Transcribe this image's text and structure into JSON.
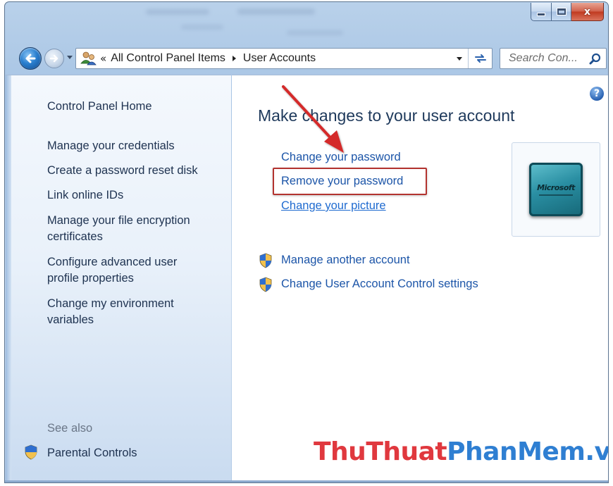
{
  "window": {
    "caption_buttons": {
      "minimize_icon": "minimize-icon",
      "maximize_icon": "maximize-icon",
      "close_icon": "close-icon",
      "close_glyph": "x"
    }
  },
  "toolbar": {
    "address": {
      "overflow_chevron": "«",
      "breadcrumbs": [
        "All Control Panel Items",
        "User Accounts"
      ]
    },
    "search": {
      "placeholder": "Search Con..."
    }
  },
  "left_pane": {
    "home_link": "Control Panel Home",
    "items": [
      "Manage your credentials",
      "Create a password reset disk",
      "Link online IDs",
      "Manage your file encryption certificates",
      "Configure advanced user profile properties",
      "Change my environment variables"
    ],
    "see_also_label": "See also",
    "see_also_items": [
      "Parental Controls"
    ]
  },
  "content": {
    "help_glyph": "?",
    "heading": "Make changes to your user account",
    "tasks": [
      "Change your password",
      "Remove your password",
      "Change your picture"
    ],
    "admin_tasks": [
      "Manage another account",
      "Change User Account Control settings"
    ],
    "user_picture": {
      "label": "Microsoft"
    }
  },
  "watermark": {
    "part1": "ThuThuat",
    "part2": "PhanMem.vn"
  },
  "colors": {
    "link": "#1c55a8",
    "highlight_box": "#b3332f",
    "arrow": "#d42a2a",
    "watermark_red": "#e0383e",
    "watermark_blue": "#2f7fd2"
  }
}
